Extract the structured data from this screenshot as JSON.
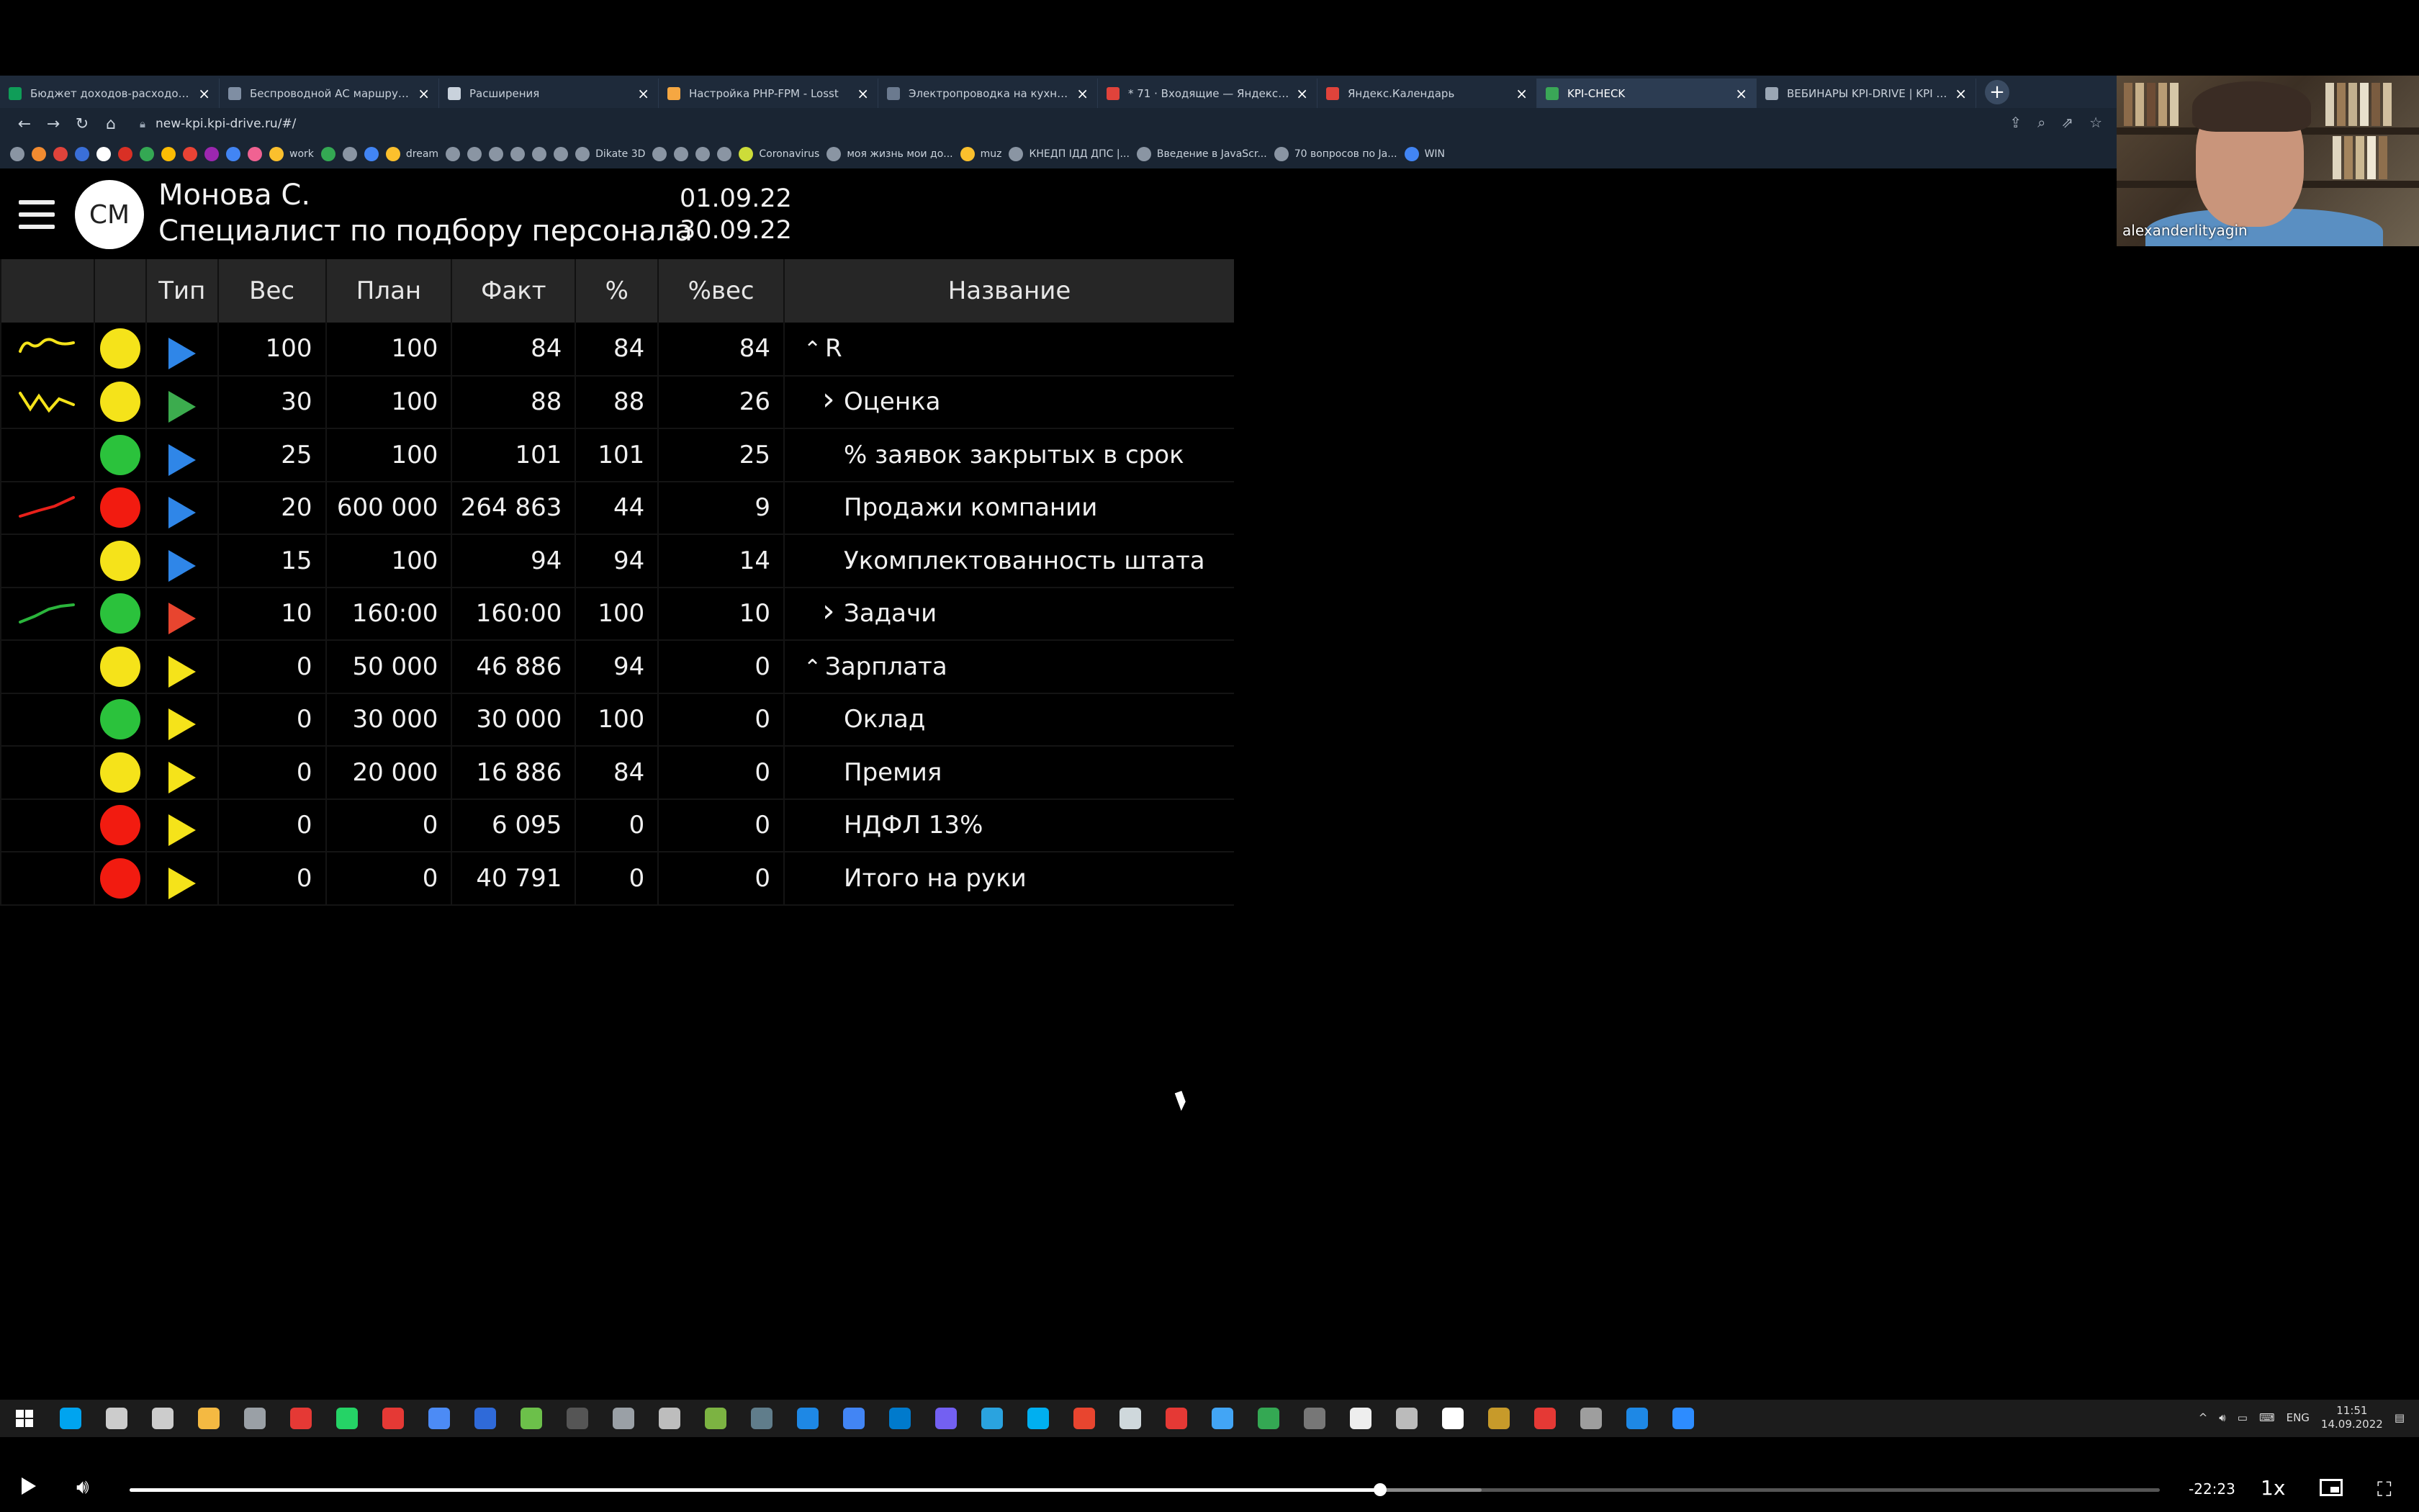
{
  "browser": {
    "tabs": [
      {
        "title": "Бюджет доходов-расходов ( с д",
        "color": "#0f9d58"
      },
      {
        "title": "Беспроводной АС маршрутиза",
        "color": "#7f8ea3"
      },
      {
        "title": "Расширения",
        "color": "#c9d2dc"
      },
      {
        "title": "Настройка PHP-FPM - Losst",
        "color": "#f5a742"
      },
      {
        "title": "Электропроводка на кухне: вы",
        "color": "#6b7a8f"
      },
      {
        "title": "* 71 · Входящие — Яндекс Почт",
        "color": "#e0433b"
      },
      {
        "title": "Яндекс.Календарь",
        "color": "#e0433b"
      },
      {
        "title": "KPI-CHECK",
        "color": "#3aa757",
        "active": true
      },
      {
        "title": "ВЕБИНАРЫ KPI-DRIVE | KPI Drive",
        "color": "#9aa6b4"
      }
    ],
    "url": "new-kpi.kpi-drive.ru/#/",
    "bookmarks": [
      {
        "label": "",
        "color": "#8a95a3"
      },
      {
        "label": "",
        "color": "#f28b30"
      },
      {
        "label": "",
        "color": "#e0433b"
      },
      {
        "label": "",
        "color": "#3a6fd8"
      },
      {
        "label": "",
        "color": "#ffffff"
      },
      {
        "label": "",
        "color": "#d93025"
      },
      {
        "label": "",
        "color": "#34a853"
      },
      {
        "label": "",
        "color": "#fbbc04"
      },
      {
        "label": "",
        "color": "#ea4335"
      },
      {
        "label": "",
        "color": "#9c27b0"
      },
      {
        "label": "",
        "color": "#4285f4"
      },
      {
        "label": "",
        "color": "#f06292"
      },
      {
        "label": "work",
        "color": "#fbc02d"
      },
      {
        "label": "",
        "color": "#34a853"
      },
      {
        "label": "",
        "color": "#8a95a3"
      },
      {
        "label": "",
        "color": "#4285f4"
      },
      {
        "label": "dream",
        "color": "#fbc02d"
      },
      {
        "label": "",
        "color": "#8a95a3"
      },
      {
        "label": "",
        "color": "#8a95a3"
      },
      {
        "label": "",
        "color": "#8a95a3"
      },
      {
        "label": "",
        "color": "#8a95a3"
      },
      {
        "label": "",
        "color": "#8a95a3"
      },
      {
        "label": "",
        "color": "#8a95a3"
      },
      {
        "label": "Dikate 3D",
        "color": "#8a95a3"
      },
      {
        "label": "",
        "color": "#8a95a3"
      },
      {
        "label": "",
        "color": "#8a95a3"
      },
      {
        "label": "",
        "color": "#8a95a3"
      },
      {
        "label": "",
        "color": "#8a95a3"
      },
      {
        "label": "Coronavirus",
        "color": "#cddc39"
      },
      {
        "label": "моя жизнь мои до...",
        "color": "#8a95a3"
      },
      {
        "label": "muz",
        "color": "#fbc02d"
      },
      {
        "label": "КНЕДП ІДД ДПС |...",
        "color": "#8a95a3"
      },
      {
        "label": "Введение в JavaScr...",
        "color": "#8a95a3"
      },
      {
        "label": "70 вопросов по Ja...",
        "color": "#8a95a3"
      },
      {
        "label": "WIN",
        "color": "#4285f4"
      }
    ]
  },
  "header": {
    "avatar_initials": "СМ",
    "employee_name": "Монова С.",
    "employee_role": "Специалист по подбору персонала",
    "date_from": "01.09.22",
    "date_to": "30.09.22"
  },
  "table": {
    "columns": [
      "",
      "",
      "Тип",
      "Вес",
      "План",
      "Факт",
      "%",
      "%вес",
      "Название"
    ],
    "rows": [
      {
        "trend": "yellow-flat",
        "status": "#f5e31a",
        "type": "#2f86e8",
        "weight": "100",
        "plan": "100",
        "fact": "84",
        "pct": "84",
        "pct_weight": "84",
        "name": "R",
        "chevron": "^",
        "level": 0
      },
      {
        "trend": "yellow-zigzag",
        "status": "#f5e31a",
        "type": "#3cac4e",
        "weight": "30",
        "plan": "100",
        "fact": "88",
        "pct": "88",
        "pct_weight": "26",
        "name": "Оценка",
        "chevron": ">",
        "level": 1
      },
      {
        "trend": "",
        "status": "#2bc23c",
        "type": "#2f86e8",
        "weight": "25",
        "plan": "100",
        "fact": "101",
        "pct": "101",
        "pct_weight": "25",
        "name": "% заявок закрытых в срок",
        "chevron": "",
        "level": 2
      },
      {
        "trend": "red-up",
        "status": "#f21b10",
        "type": "#2f86e8",
        "weight": "20",
        "plan": "600 000",
        "fact": "264 863",
        "pct": "44",
        "pct_weight": "9",
        "name": "Продажи компании",
        "chevron": "",
        "level": 2
      },
      {
        "trend": "",
        "status": "#f5e31a",
        "type": "#2f86e8",
        "weight": "15",
        "plan": "100",
        "fact": "94",
        "pct": "94",
        "pct_weight": "14",
        "name": "Укомплектованность штата",
        "chevron": "",
        "level": 2
      },
      {
        "trend": "green-up",
        "status": "#2bc23c",
        "type": "#e8452f",
        "weight": "10",
        "plan": "160:00",
        "fact": "160:00",
        "pct": "100",
        "pct_weight": "10",
        "name": "Задачи",
        "chevron": ">",
        "level": 1
      },
      {
        "trend": "",
        "status": "#f5e31a",
        "type": "#f5e31a",
        "weight": "0",
        "plan": "50 000",
        "fact": "46 886",
        "pct": "94",
        "pct_weight": "0",
        "name": "Зарплата",
        "chevron": "^",
        "level": 0
      },
      {
        "trend": "",
        "status": "#2bc23c",
        "type": "#f5e31a",
        "weight": "0",
        "plan": "30 000",
        "fact": "30 000",
        "pct": "100",
        "pct_weight": "0",
        "name": "Оклад",
        "chevron": "",
        "level": 2
      },
      {
        "trend": "",
        "status": "#f5e31a",
        "type": "#f5e31a",
        "weight": "0",
        "plan": "20 000",
        "fact": "16 886",
        "pct": "84",
        "pct_weight": "0",
        "name": "Премия",
        "chevron": "",
        "level": 2
      },
      {
        "trend": "",
        "status": "#f21b10",
        "type": "#f5e31a",
        "weight": "0",
        "plan": "0",
        "fact": "6 095",
        "pct": "0",
        "pct_weight": "0",
        "name": "НДФЛ 13%",
        "chevron": "",
        "level": 2
      },
      {
        "trend": "",
        "status": "#f21b10",
        "type": "#f5e31a",
        "weight": "0",
        "plan": "0",
        "fact": "40 791",
        "pct": "0",
        "pct_weight": "0",
        "name": "Итого на руки",
        "chevron": "",
        "level": 2
      }
    ]
  },
  "webcam": {
    "participant_name": "alexanderlityagin"
  },
  "taskbar": {
    "icons": [
      "#00a4ef",
      "#cccccc",
      "#cccccc",
      "#f4b942",
      "#9aa0a6",
      "#e53935",
      "#25d366",
      "#e53935",
      "#4c8bf5",
      "#2f6ad9",
      "#6cc04a",
      "#555555",
      "#9aa0a6",
      "#bdbdbd",
      "#7cb342",
      "#607d8b",
      "#1e88e5",
      "#4285f4",
      "#007acc",
      "#7360f2",
      "#2aa3df",
      "#00aff0",
      "#e8452f",
      "#cfd8dc",
      "#e53935",
      "#42a5f5",
      "#34a853",
      "#777777",
      "#eeeeee",
      "#bbbbbb",
      "#ffffff",
      "#c79a2a",
      "#e53935",
      "#9e9e9e",
      "#1e88e5",
      "#2d8cff"
    ],
    "lang": "ENG",
    "time": "11:51",
    "date": "14.09.2022"
  },
  "player": {
    "time_remaining": "-22:23",
    "speed": "1x",
    "progress": 0.616,
    "buffered": 0.666
  }
}
